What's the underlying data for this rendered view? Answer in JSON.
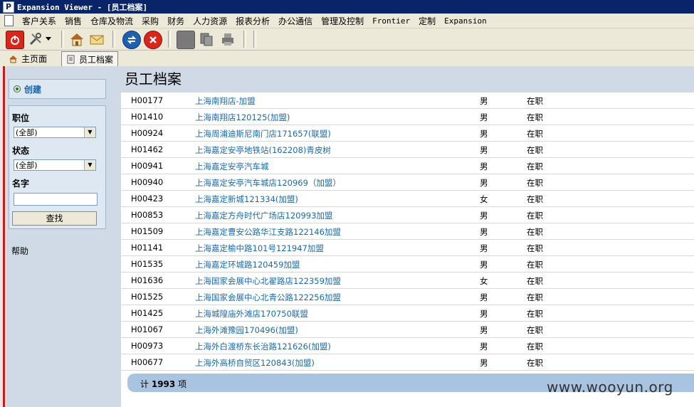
{
  "window": {
    "title": "Expansion Viewer - [员工档案]",
    "app_icon": "P"
  },
  "menu": [
    "客户关系",
    "销售",
    "仓库及物流",
    "采购",
    "财务",
    "人力资源",
    "报表分析",
    "办公通信",
    "管理及控制",
    "Frontier",
    "定制",
    "Expansion"
  ],
  "tabs": [
    {
      "label": "主页面",
      "icon": "home-icon"
    },
    {
      "label": "员工档案",
      "icon": "document-icon"
    }
  ],
  "sidebar": {
    "create_label": "创建",
    "filter": {
      "position_label": "职位",
      "position_value": "(全部)",
      "status_label": "状态",
      "status_value": "(全部)",
      "name_label": "名字",
      "name_value": "",
      "search_button": "查找"
    },
    "help_label": "帮助"
  },
  "main": {
    "title": "员工档案",
    "rows": [
      {
        "code": "H00177",
        "name": "上海南翔店-加盟",
        "sex": "男",
        "status": "在职"
      },
      {
        "code": "H01410",
        "name": "上海南翔店120125(加盟)",
        "sex": "男",
        "status": "在职"
      },
      {
        "code": "H00924",
        "name": "上海周浦迪斯尼南门店171657(联盟)",
        "sex": "男",
        "status": "在职"
      },
      {
        "code": "H01462",
        "name": "上海嘉定安亭地铁站(162208)青皮树",
        "sex": "男",
        "status": "在职"
      },
      {
        "code": "H00941",
        "name": "上海嘉定安亭汽车城",
        "sex": "男",
        "status": "在职"
      },
      {
        "code": "H00940",
        "name": "上海嘉定安亭汽车城店120969（加盟）",
        "sex": "男",
        "status": "在职"
      },
      {
        "code": "H00423",
        "name": "上海嘉定新城121334(加盟)",
        "sex": "女",
        "status": "在职"
      },
      {
        "code": "H00853",
        "name": "上海嘉定方舟时代广场店120993加盟",
        "sex": "男",
        "status": "在职"
      },
      {
        "code": "H01509",
        "name": "上海嘉定曹安公路华江支路122146加盟",
        "sex": "男",
        "status": "在职"
      },
      {
        "code": "H01141",
        "name": "上海嘉定榆中路101号121947加盟",
        "sex": "男",
        "status": "在职"
      },
      {
        "code": "H01535",
        "name": "上海嘉定环城路120459加盟",
        "sex": "男",
        "status": "在职"
      },
      {
        "code": "H01636",
        "name": "上海国家会展中心北翟路店122359加盟",
        "sex": "女",
        "status": "在职"
      },
      {
        "code": "H01525",
        "name": "上海国家会展中心北青公路122256加盟",
        "sex": "男",
        "status": "在职"
      },
      {
        "code": "H01425",
        "name": "上海城隍庙外滩店170750联盟",
        "sex": "男",
        "status": "在职"
      },
      {
        "code": "H01067",
        "name": "上海外滩豫园170496(加盟)",
        "sex": "男",
        "status": "在职"
      },
      {
        "code": "H00973",
        "name": "上海外白渡桥东长治路121626(加盟)",
        "sex": "男",
        "status": "在职"
      },
      {
        "code": "H00677",
        "name": "上海外高桥自贸区120843(加盟)",
        "sex": "男",
        "status": "在职"
      }
    ],
    "footer": {
      "prefix": "计",
      "count": "1993",
      "suffix": "项"
    }
  },
  "watermark": "www.wooyun.org",
  "colors": {
    "title_bar": "#0a246a",
    "panel_blue": "#d0dae6",
    "link": "#1a6ab0",
    "footer_bar": "#a9c4e0",
    "accent_red": "#d01818"
  }
}
